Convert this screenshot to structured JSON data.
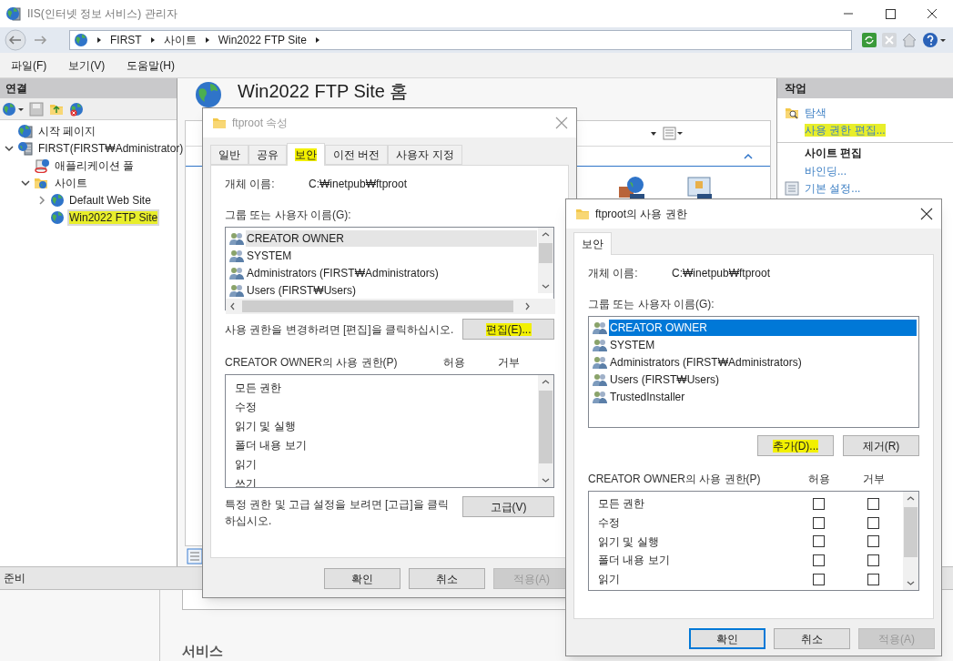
{
  "window": {
    "title": "IIS(인터넷 정보 서비스) 관리자"
  },
  "address_bar": {
    "crumbs": [
      "FIRST",
      "사이트",
      "Win2022 FTP Site"
    ]
  },
  "menu": [
    "파일(F)",
    "보기(V)",
    "도움말(H)"
  ],
  "connections": {
    "title": "연결",
    "tree": [
      {
        "label": "시작 페이지",
        "kind": "start",
        "selected": false,
        "highlighted": false
      },
      {
        "label": "FIRST(FIRST₩Administrator)",
        "kind": "server",
        "expanded": true,
        "selected": false,
        "highlighted": false,
        "children": [
          {
            "label": "애플리케이션 풀",
            "kind": "pool",
            "selected": false,
            "highlighted": false
          },
          {
            "label": "사이트",
            "kind": "sites",
            "expanded": true,
            "selected": false,
            "highlighted": false,
            "children": [
              {
                "label": "Default Web Site",
                "kind": "site",
                "expanded": false,
                "selected": false,
                "highlighted": false
              },
              {
                "label": "Win2022 FTP Site",
                "kind": "site",
                "selected": true,
                "highlighted": true
              }
            ]
          }
        ]
      }
    ]
  },
  "home": {
    "title": "Win2022 FTP Site 홈",
    "section": "서비스"
  },
  "actions": {
    "title": "작업",
    "items": [
      {
        "kind": "explore",
        "label": "탐색",
        "highlighted": false
      },
      {
        "kind": "link",
        "label": "사용 권한 편집...",
        "highlighted": true
      },
      {
        "kind": "heading",
        "label": "사이트 편집",
        "highlighted": false
      },
      {
        "kind": "link",
        "label": "바인딩...",
        "highlighted": false
      },
      {
        "kind": "settings",
        "label": "기본 설정...",
        "highlighted": false
      }
    ]
  },
  "status_bar": "준비",
  "properties_dialog": {
    "title": "ftproot 속성",
    "active": false,
    "tabs": [
      {
        "label": "일반",
        "selected": false,
        "highlighted": false
      },
      {
        "label": "공유",
        "selected": false,
        "highlighted": false
      },
      {
        "label": "보안",
        "selected": true,
        "highlighted": true
      },
      {
        "label": "이전 버전",
        "selected": false,
        "highlighted": false
      },
      {
        "label": "사용자 지정",
        "selected": false,
        "highlighted": false
      }
    ],
    "object_label": "개체 이름:",
    "object_value": "C:₩inetpub₩ftproot",
    "group_label": "그룹 또는 사용자 이름(G):",
    "principals": [
      {
        "name": "CREATOR OWNER",
        "selected": true
      },
      {
        "name": "SYSTEM",
        "selected": false
      },
      {
        "name": "Administrators (FIRST₩Administrators)",
        "selected": false
      },
      {
        "name": "Users (FIRST₩Users)",
        "selected": false
      }
    ],
    "edit_hint": "사용 권한을 변경하려면 [편집]을 클릭하십시오.",
    "edit_button": {
      "label": "편집(E)...",
      "highlighted": true
    },
    "perm_label": "CREATOR OWNER의 사용 권한(P)",
    "allow_label": "허용",
    "deny_label": "거부",
    "permissions": [
      {
        "name": "모든 권한"
      },
      {
        "name": "수정"
      },
      {
        "name": "읽기 및 실행"
      },
      {
        "name": "폴더 내용 보기"
      },
      {
        "name": "읽기"
      },
      {
        "name": "쓰기"
      }
    ],
    "advanced_hint": "특정 권한 및 고급 설정을 보려면 [고급]을 클릭하십시오.",
    "advanced_button": {
      "label": "고급(V)",
      "highlighted": false
    },
    "buttons": [
      {
        "label": "확인",
        "default": false,
        "disabled": false
      },
      {
        "label": "취소",
        "default": false,
        "disabled": false
      },
      {
        "label": "적용(A)",
        "default": false,
        "disabled": true
      }
    ]
  },
  "permissions_dialog": {
    "title": "ftproot의 사용 권한",
    "active": true,
    "tabs": [
      {
        "label": "보안",
        "selected": true,
        "highlighted": false
      }
    ],
    "object_label": "개체 이름:",
    "object_value": "C:₩inetpub₩ftproot",
    "group_label": "그룹 또는 사용자 이름(G):",
    "principals": [
      {
        "name": "CREATOR OWNER",
        "selected": true
      },
      {
        "name": "SYSTEM",
        "selected": false
      },
      {
        "name": "Administrators (FIRST₩Administrators)",
        "selected": false
      },
      {
        "name": "Users (FIRST₩Users)",
        "selected": false
      },
      {
        "name": "TrustedInstaller",
        "selected": false
      }
    ],
    "list_buttons": [
      {
        "label": "추가(D)...",
        "highlighted": true
      },
      {
        "label": "제거(R)",
        "highlighted": false
      }
    ],
    "perm_label": "CREATOR OWNER의 사용 권한(P)",
    "allow_label": "허용",
    "deny_label": "거부",
    "permissions": [
      {
        "name": "모든 권한",
        "allow": false,
        "deny": false
      },
      {
        "name": "수정",
        "allow": false,
        "deny": false
      },
      {
        "name": "읽기 및 실행",
        "allow": false,
        "deny": false
      },
      {
        "name": "폴더 내용 보기",
        "allow": false,
        "deny": false
      },
      {
        "name": "읽기",
        "allow": false,
        "deny": false
      }
    ],
    "buttons": [
      {
        "label": "확인",
        "default": true,
        "disabled": false
      },
      {
        "label": "취소",
        "default": false,
        "disabled": false
      },
      {
        "label": "적용(A)",
        "default": false,
        "disabled": true
      }
    ]
  }
}
